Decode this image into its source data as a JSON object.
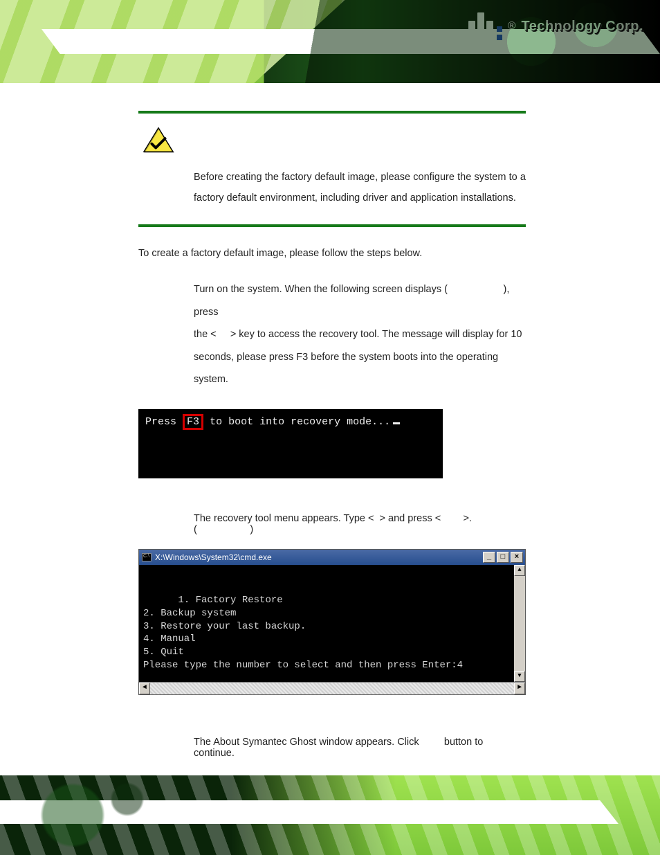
{
  "brand": {
    "registered": "®",
    "name": "Technology Corp."
  },
  "note": {
    "body": "Before creating the factory default image, please configure the system to a factory default environment, including driver and application installations."
  },
  "intro": "To create a factory default image, please follow the steps below.",
  "steps": {
    "s1a": "Turn on the system. When the following screen displays (",
    "s1b": "), press",
    "s1c": "the <",
    "s1d": "> key to access the recovery tool. The message will display for 10",
    "s1e": "seconds, please press F3 before the system boots into the operating system.",
    "s2a": "The recovery tool menu appears. Type <",
    "s2b": "> and press <",
    "s2c": ">. (",
    "s2d": ")",
    "s3a": "The About Symantec Ghost window appears. Click",
    "s3b": "button to continue."
  },
  "term1": {
    "pre": "Press",
    "hl": "F3",
    "post": "to boot into recovery mode..."
  },
  "cmd": {
    "title": "X:\\Windows\\System32\\cmd.exe",
    "lines": "1. Factory Restore\n2. Backup system\n3. Restore your last backup.\n4. Manual\n5. Quit\nPlease type the number to select and then press Enter:4"
  },
  "winbuttons": {
    "min": "_",
    "max": "□",
    "close": "×"
  },
  "scroll": {
    "left": "◄",
    "right": "►",
    "up": "▲",
    "down": "▼"
  }
}
